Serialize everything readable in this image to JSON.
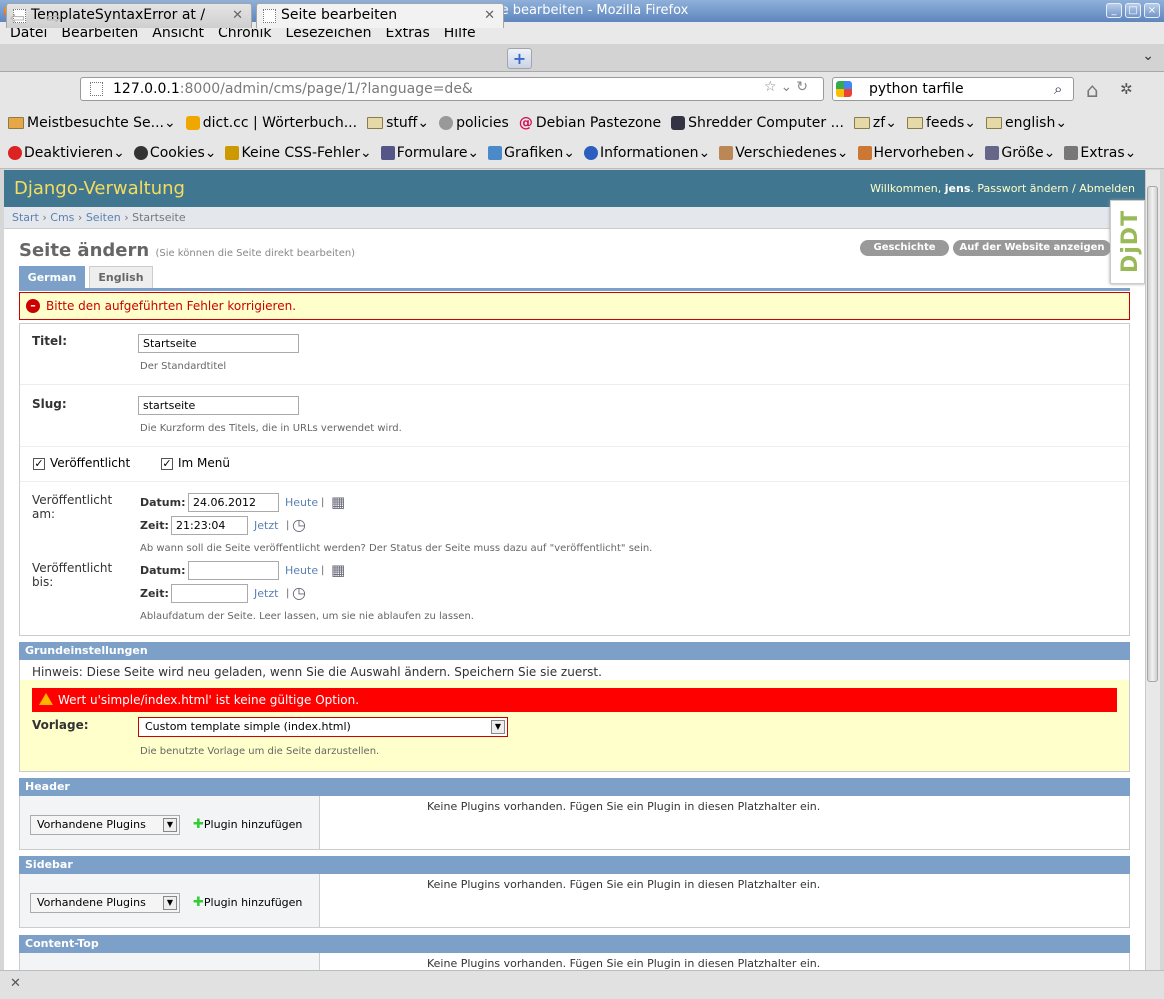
{
  "window": {
    "title": "Seite bearbeiten - Mozilla Firefox"
  },
  "menu": [
    "Datei",
    "Bearbeiten",
    "Ansicht",
    "Chronik",
    "Lesezeichen",
    "Extras",
    "Hilfe"
  ],
  "tabs": [
    {
      "label": "TemplateSyntaxError at /",
      "close": "✕"
    },
    {
      "label": "Seite bearbeiten",
      "close": "✕"
    }
  ],
  "newtab": "+",
  "tabmenu": "⌄",
  "nav": {
    "back": "⇦",
    "forward": "⇨",
    "url_host": "127.0.0.1",
    "url_rest": ":8000/admin/cms/page/1/?language=de&",
    "url_icons": "☆⌄↻",
    "search": "python tarfile",
    "search_icon": "⌕",
    "home": "⌂"
  },
  "bookmarks": [
    "Meistbesuchte Se...⌄",
    "dict.cc | Wörterbuch...",
    "stuff⌄",
    "policies",
    "Debian Pastezone",
    "Shredder Computer ...",
    "zf⌄",
    "feeds⌄",
    "english⌄"
  ],
  "webdev": [
    "Deaktivieren⌄",
    "Cookies⌄",
    "Keine CSS-Fehler⌄",
    "Formulare⌄",
    "Grafiken⌄",
    "Informationen⌄",
    "Verschiedenes⌄",
    "Hervorheben⌄",
    "Größe⌄",
    "Extras⌄"
  ],
  "django": {
    "title": "Django-Verwaltung",
    "welcome": "Willkommen,",
    "user": "jens",
    "links": ". Passwort ändern / Abmelden",
    "crumbs": [
      "Start",
      "Cms",
      "Seiten",
      "Startseite"
    ],
    "crumb_sep": "›",
    "page_title": "Seite ändern",
    "page_sub": "(Sie können die Seite direkt bearbeiten)",
    "tools": [
      "Geschichte",
      "Auf der Website anzeigen"
    ],
    "ddt": "DjDT",
    "lang_tabs": [
      "German",
      "English"
    ],
    "error": "Bitte den aufgeführten Fehler korrigieren.",
    "error_icon": "–",
    "titel_label": "Titel:",
    "titel_value": "Startseite",
    "titel_help": "Der Standardtitel",
    "slug_label": "Slug:",
    "slug_value": "startseite",
    "slug_help": "Die Kurzform des Titels, die in URLs verwendet wird.",
    "check_mark": "✓",
    "published": "Veröffentlicht",
    "in_menu": "Im Menü",
    "pub_from": "Veröffentlicht am:",
    "datum": "Datum:",
    "zeit": "Zeit:",
    "date_value": "24.06.2012",
    "time_value": "21:23:04",
    "heute": "Heute",
    "jetzt": "Jetzt",
    "link_sep": "|",
    "cal_icon": "▦",
    "clock_icon": "◷",
    "pub_from_help": "Ab wann soll die Seite veröffentlicht werden? Der Status der Seite muss dazu auf \"veröffentlicht\" sein.",
    "pub_until": "Veröffentlicht bis:",
    "pub_until_help": "Ablaufdatum der Seite. Leer lassen, um sie nie ablaufen zu lassen.",
    "grund": "Grundeinstellungen",
    "hint": "Hinweis: Diese Seite wird neu geladen, wenn Sie die Auswahl ändern. Speichern Sie sie zuerst.",
    "template_error": "Wert u'simple/index.html' ist keine gültige Option.",
    "vorlage": "Vorlage:",
    "vorlage_value": "Custom template simple (index.html)",
    "vorlage_help": "Die benutzte Vorlage um die Seite darzustellen.",
    "select_arrow": "▼",
    "sections": [
      "Header",
      "Sidebar",
      "Content-Top"
    ],
    "plugins_select": "Vorhandene Plugins",
    "plugin_plus": "✚",
    "add_plugin": "Plugin hinzufügen",
    "no_plugins": "Keine Plugins vorhanden. Fügen Sie ein Plugin in diesen Platzhalter ein."
  },
  "status": {
    "close": "✕"
  }
}
